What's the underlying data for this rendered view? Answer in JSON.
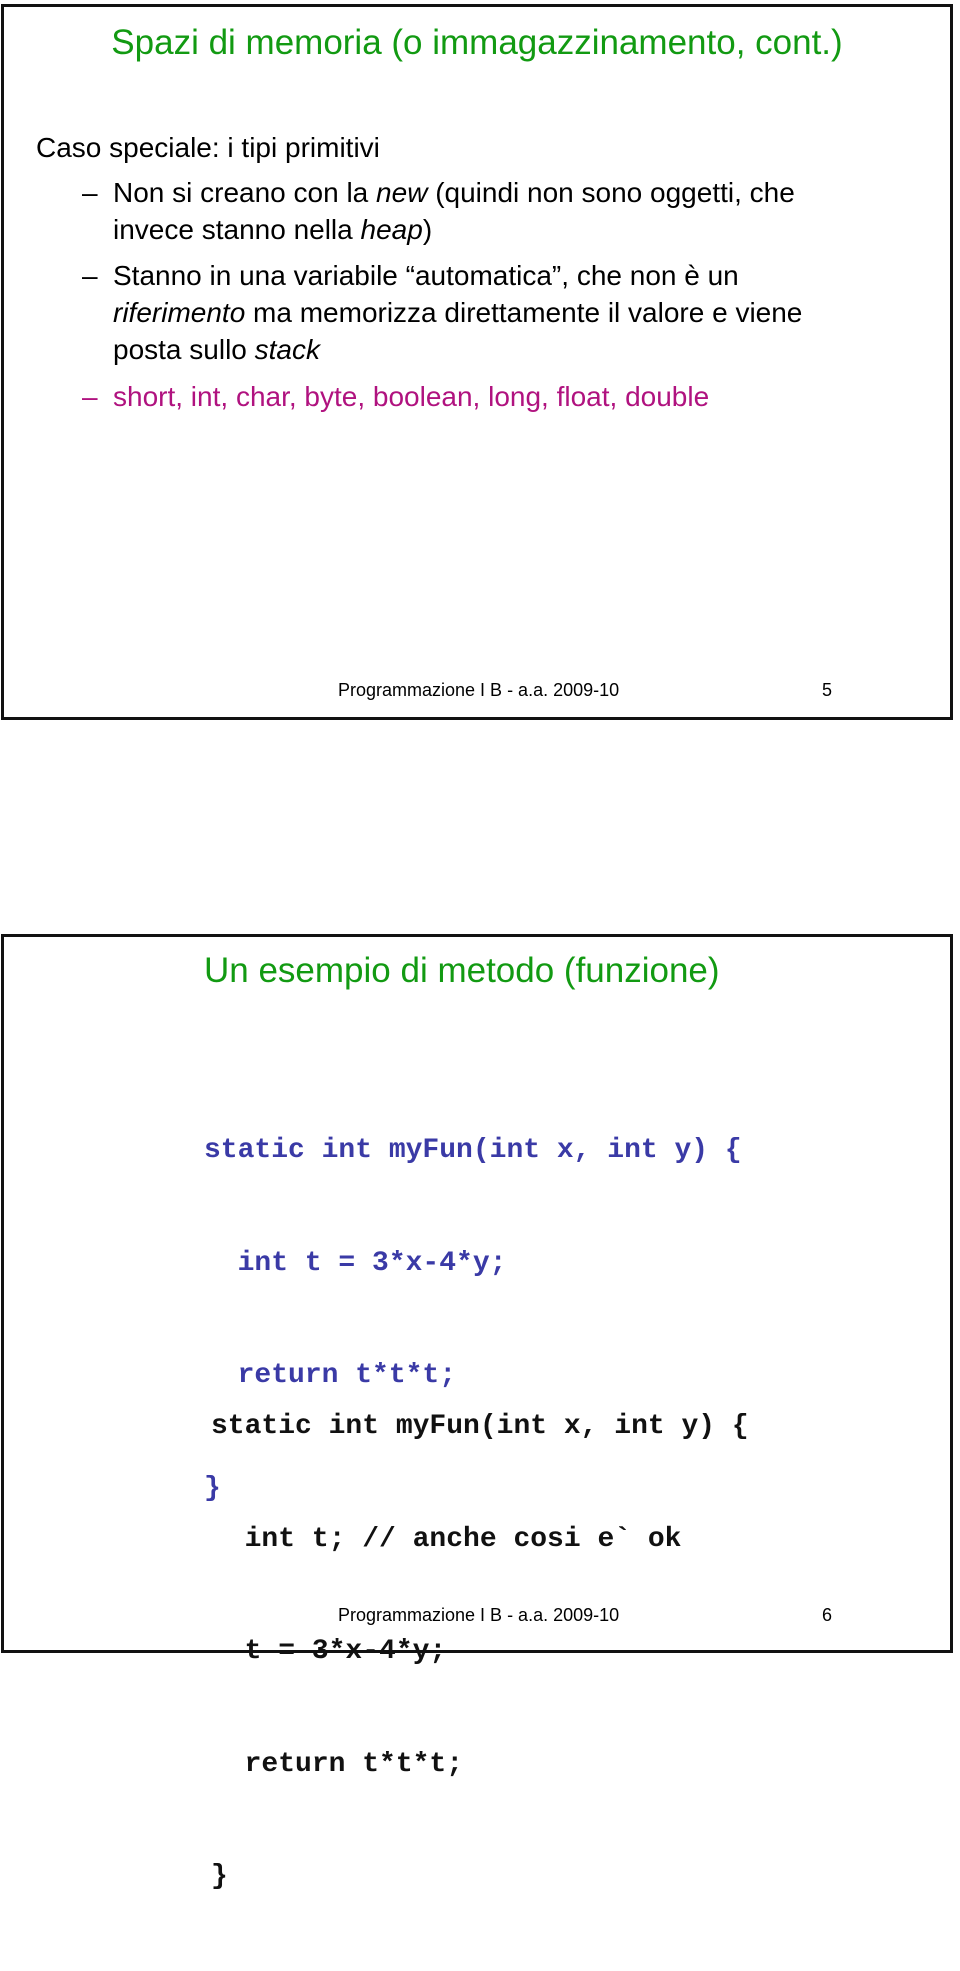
{
  "slides": [
    {
      "title": "Spazi di memoria (o immagazzinamento, cont.)",
      "heading": "Caso speciale: i tipi primitivi",
      "bullets": [
        {
          "dash": "–",
          "lines": [
            {
              "parts": [
                "Non si creano con la ",
                "new",
                " (quindi non sono oggetti, che"
              ]
            },
            {
              "parts": [
                "invece stanno nella ",
                "heap",
                ")"
              ]
            }
          ]
        },
        {
          "dash": "–",
          "lines": [
            {
              "parts": [
                "Stanno in una variabile “automatica”, che non è un"
              ]
            },
            {
              "parts": [
                "",
                "riferimento",
                " ma memorizza direttamente il valore e viene"
              ]
            },
            {
              "parts": [
                "posta sullo ",
                "stack",
                ""
              ]
            }
          ]
        },
        {
          "dash": "–",
          "text": "short, int, char, byte, boolean, long, float, double",
          "color": "#b0127f"
        }
      ],
      "footer": {
        "course": "Programmazione I B - a.a. 2009-10",
        "page": "5"
      }
    },
    {
      "title": "Un esempio di metodo (funzione)",
      "code_blocks": [
        {
          "color": "#3a3aa6",
          "lines": [
            "static int myFun(int x, int y) {",
            "  int t = 3*x-4*y;",
            "  return t*t*t;",
            "}"
          ]
        },
        {
          "color": "#111111",
          "lines": [
            "static int myFun(int x, int y) {",
            "  int t; // anche cosi e` ok",
            "  t = 3*x-4*y;",
            "  return t*t*t;",
            "}"
          ]
        }
      ],
      "footer": {
        "course": "Programmazione I B - a.a. 2009-10",
        "page": "6"
      }
    }
  ],
  "colors": {
    "title": "#129a12",
    "highlight": "#b0127f",
    "code_primary": "#3a3aa6",
    "code_secondary": "#111111"
  }
}
